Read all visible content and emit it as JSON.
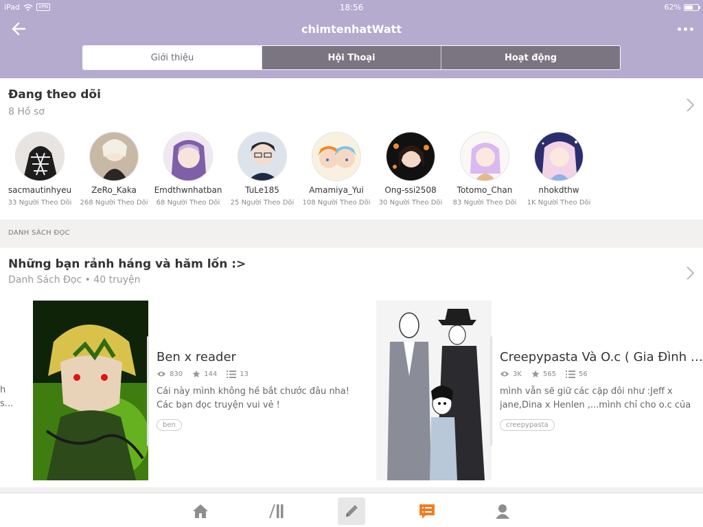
{
  "status_bar": {
    "device": "iPad",
    "vpn": "VPN",
    "time": "18:56",
    "battery_text": "62%",
    "battery_level": 0.62
  },
  "header": {
    "title": "chimtenhatWatt"
  },
  "tabs": [
    {
      "label": "Giới thiệu",
      "active": true
    },
    {
      "label": "Hội Thoại",
      "active": false
    },
    {
      "label": "Hoạt động",
      "active": false
    }
  ],
  "following": {
    "title": "Đang theo dõi",
    "subtitle": "8 Hồ sơ",
    "profiles": [
      {
        "name": "sacmautinhyeu",
        "followers": "33 Người Theo Dõi"
      },
      {
        "name": "ZeRo_Kaka",
        "followers": "268 Người Theo Dõi"
      },
      {
        "name": "Emdthwnhatban",
        "followers": "68 Người Theo Dõi"
      },
      {
        "name": "TuLe185",
        "followers": "25 Người Theo Dõi"
      },
      {
        "name": "Amamiya_Yui",
        "followers": "108 Người Theo Dõi"
      },
      {
        "name": "Ong-ssi2508",
        "followers": "30 Người Theo Dõi"
      },
      {
        "name": "Totomo_Chan",
        "followers": "83 Người Theo Dõi"
      },
      {
        "name": "nhokdthw",
        "followers": "1K Người Theo Dõi"
      }
    ]
  },
  "section_label": "DANH SÁCH ĐỌC",
  "reading_list": {
    "title": "Những bạn rảnh háng và hăm lốn :>",
    "subtitle": "Danh Sách Đọc • 40 truyện",
    "peek_text": "h\ns...",
    "stories": [
      {
        "title": "Ben x reader",
        "reads": "830",
        "votes": "144",
        "parts": "13",
        "description": "Cái này mình không hề bắt chước đâu nha! Các bạn đọc truyện vui vẻ !",
        "tag": "ben"
      },
      {
        "title": "Creepypasta Và O.c ( Gia Đình Mơ Ước )",
        "reads": "3K",
        "votes": "565",
        "parts": "56",
        "description": "mình vẫn sẽ giữ các cặp đôi như :Jeff x jane,Dina x Henlen ,...mình chỉ cho o.c của các bạn",
        "tag": "creepypasta"
      }
    ]
  },
  "bottom_nav": [
    {
      "icon": "home-icon"
    },
    {
      "icon": "library-icon"
    },
    {
      "icon": "write-icon",
      "active": true
    },
    {
      "icon": "messages-icon"
    },
    {
      "icon": "profile-icon"
    }
  ],
  "colors": {
    "header_bg": "#b4abcf",
    "accent": "#f57c1f",
    "tab_inactive": "#7a7580"
  }
}
